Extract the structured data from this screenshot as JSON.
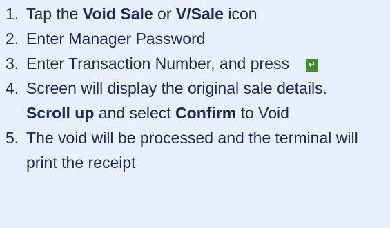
{
  "steps": [
    {
      "number": "1.",
      "pre": "Tap the ",
      "bold1": "Void Sale",
      "mid": " or ",
      "bold2": "V/Sale",
      "post": " icon"
    },
    {
      "number": "2.",
      "text": "Enter Manager Password"
    },
    {
      "number": "3.",
      "text": "Enter Transaction Number, and press",
      "icon": "enter-key-icon",
      "icon_glyph": "↵",
      "icon_color": "#3e8e2a"
    },
    {
      "number": "4.",
      "pre": "Screen will display the original sale details. ",
      "bold1": "Scroll up",
      "mid": " and select ",
      "bold2": "Confirm",
      "post": " to Void"
    },
    {
      "number": "5.",
      "text": "The void will be processed and the terminal will print the receipt"
    }
  ],
  "colors": {
    "background": "#e8f0fb",
    "text": "#1a2a5e"
  }
}
